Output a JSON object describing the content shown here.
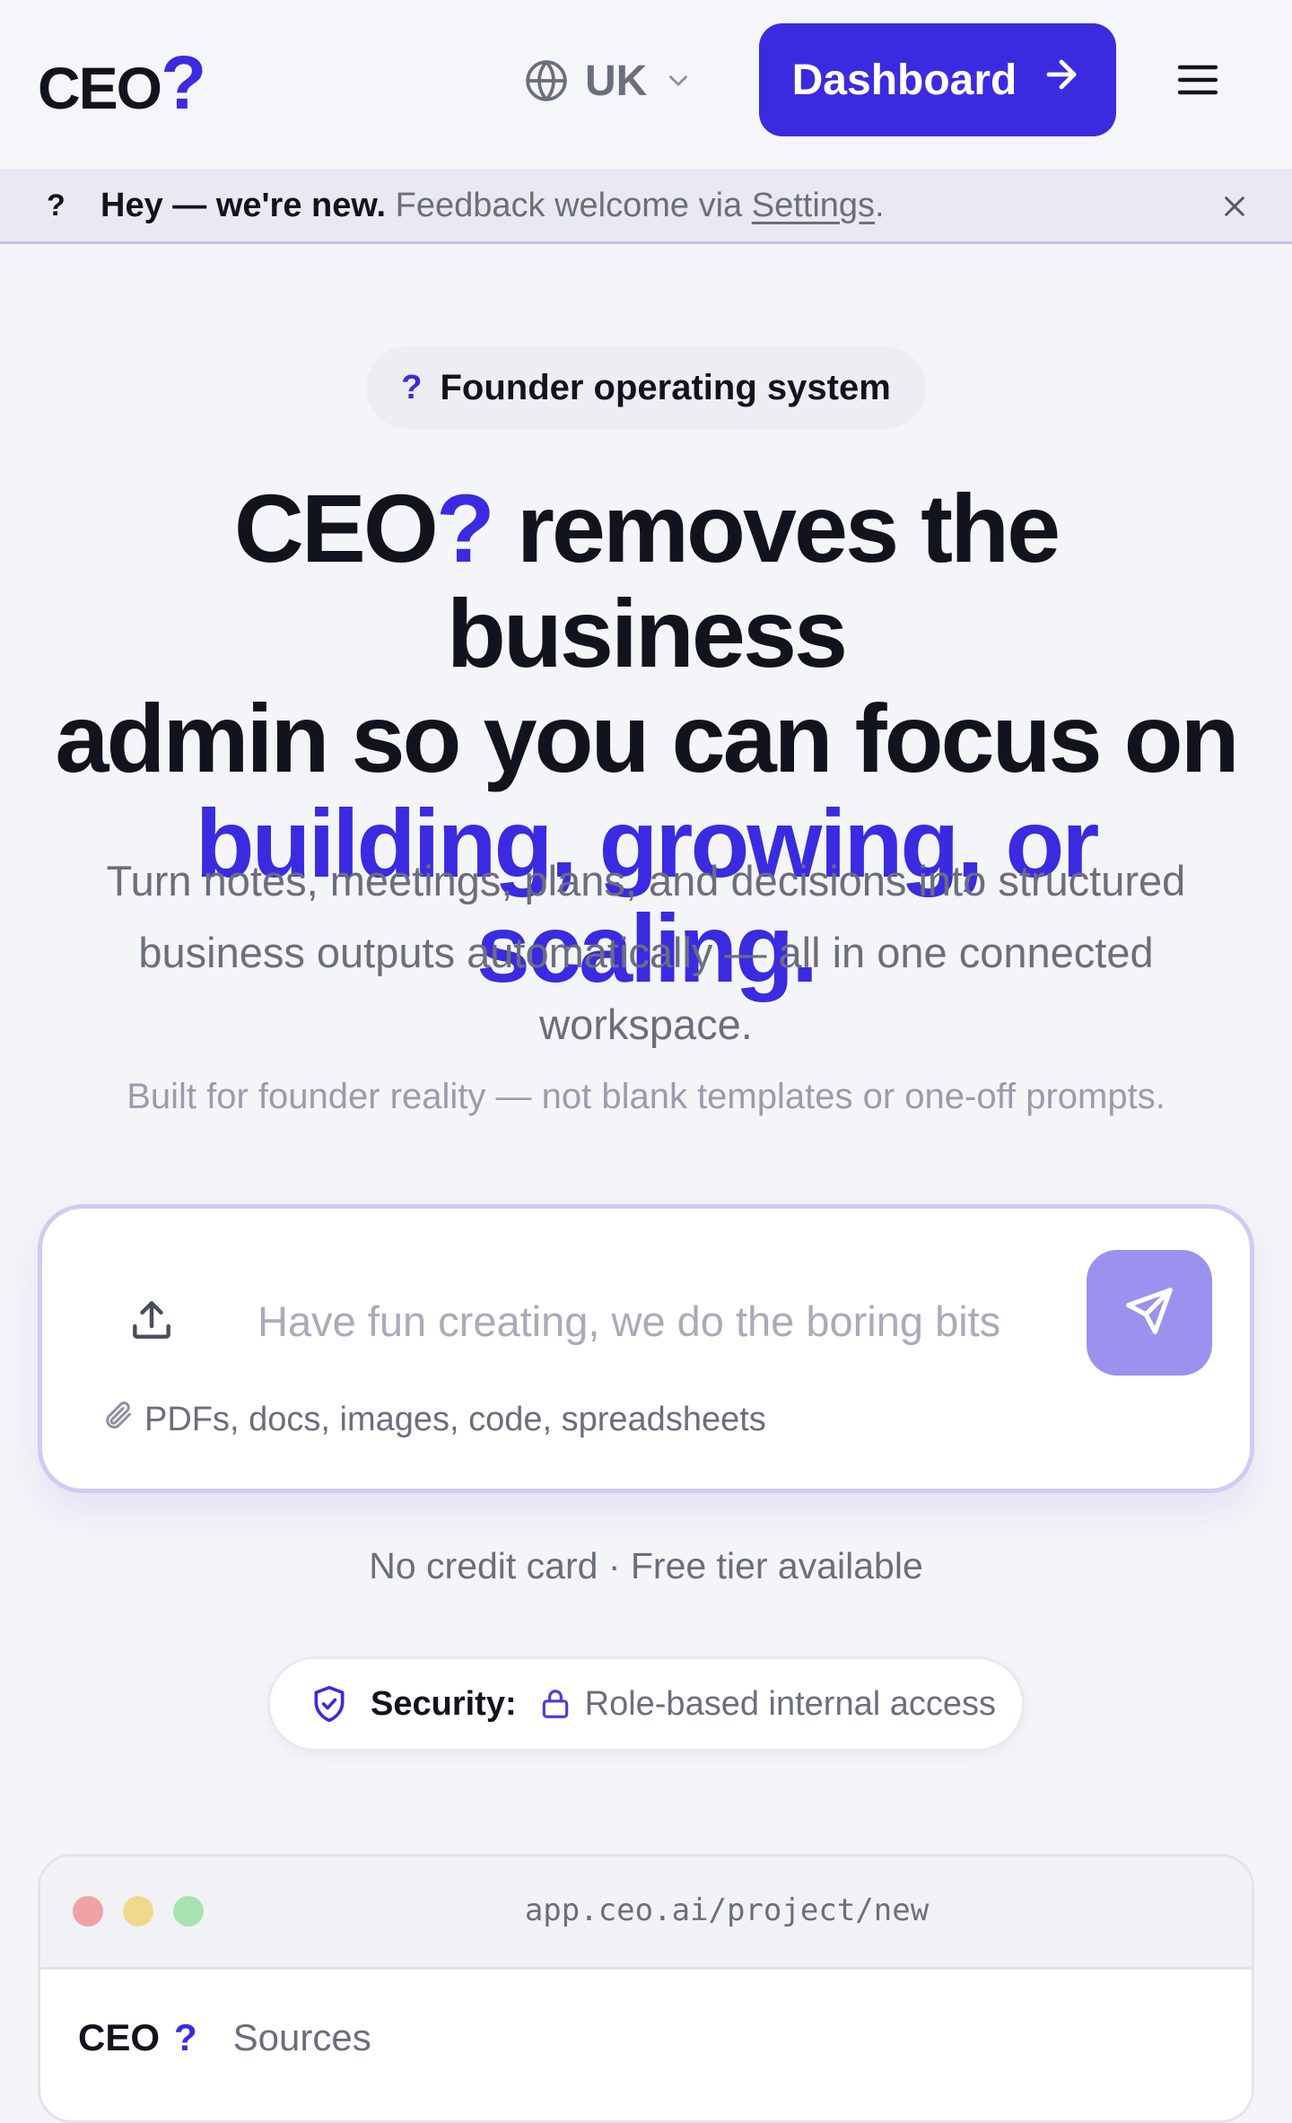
{
  "header": {
    "logo_text": "CEO",
    "logo_mark": "?",
    "language": {
      "icon": "globe-icon",
      "label": "UK",
      "chevron": "chevron-down-icon"
    },
    "dashboard_button": {
      "label": "Dashboard",
      "icon": "arrow-right-icon"
    },
    "menu_icon": "hamburger-menu-icon"
  },
  "banner": {
    "icon_text": "?",
    "strong_text": "Hey — we're new.",
    "text": "Feedback welcome via",
    "link_text": "Settings",
    "trailing": ".",
    "close_icon": "close-icon"
  },
  "hero": {
    "pill": {
      "mark": "?",
      "label": "Founder operating system"
    },
    "headline": {
      "brand": "CEO",
      "brand_mark": "?",
      "rest_line1": " removes the business",
      "line2": "admin so you can focus on",
      "accent": "building, growing, or scaling."
    },
    "lead": "Turn notes, meetings, plans, and decisions into structured business outputs automatically — all in one connected workspace.",
    "sub": "Built for founder reality — not blank templates or one-off prompts."
  },
  "composer": {
    "upload_icon": "upload-icon",
    "placeholder": "Have fun creating, we do the boring bits",
    "value": "",
    "send_icon": "send-icon",
    "file_hint": "PDFs, docs, images, code, spreadsheets",
    "file_hint_icon": "paperclip-icon"
  },
  "reassurance": "No credit card · Free tier available",
  "security": {
    "icon": "shield-check-icon",
    "label": "Security:",
    "lock_icon": "lock-icon",
    "text": "Role-based internal access"
  },
  "preview": {
    "url": "app.ceo.ai/project/new",
    "app_logo": "CEO",
    "app_mark": "?",
    "tab": "Sources"
  },
  "colors": {
    "brand": "#3b2be0",
    "send_button": "#9a92ee",
    "background": "#f4f5f8",
    "banner_bg": "#e9e9f3"
  }
}
